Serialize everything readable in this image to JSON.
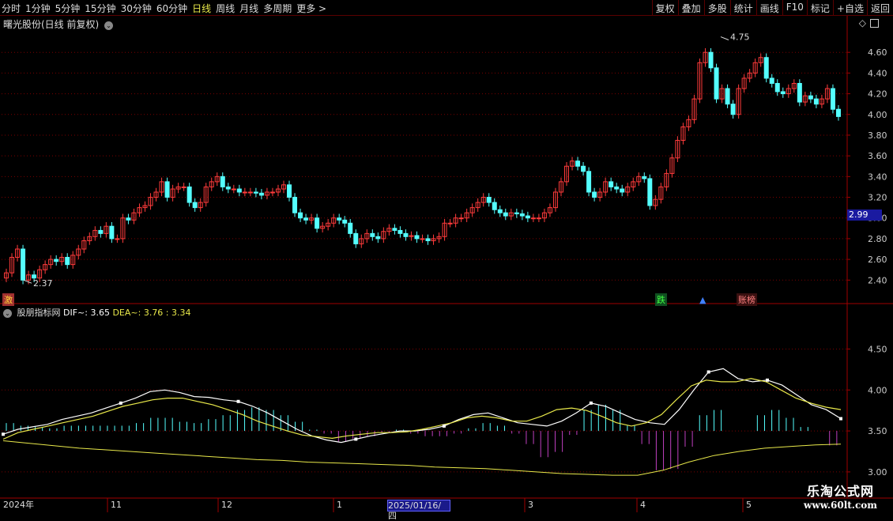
{
  "toolbar": {
    "left": [
      "分时",
      "1分钟",
      "5分钟",
      "15分钟",
      "30分钟",
      "60分钟",
      "日线",
      "周线",
      "月线",
      "多周期",
      "更多 >"
    ],
    "active_index": 6,
    "right": [
      "复权",
      "叠加",
      "多股",
      "统计",
      "画线",
      "F10",
      "标记",
      "+自选",
      "返回"
    ]
  },
  "main_title": "曙光股份(日线 前复权)",
  "indicator_title": {
    "name": "股朋指标网",
    "dif_label": "DIF~: 3.65",
    "dea_label": "DEA~: 3.76 : 3.34"
  },
  "price_box": "2.99",
  "badges": {
    "left": "激",
    "drop": "跌",
    "limit": "账榜"
  },
  "dates": {
    "year": "2024年",
    "selected": "2025/01/16/四",
    "months": [
      "11",
      "12",
      "1",
      "3",
      "4",
      "5"
    ]
  },
  "logo": {
    "line1": "乐淘公式网",
    "line2": "www.60lt.com"
  },
  "colors": {
    "up": "#ff3b3b",
    "down": "#54ffff",
    "grid": "#7a0000",
    "axis": "#a00000",
    "dif": "#ffffff",
    "dea": "#e8e84a",
    "hist_pos": "#54ffff",
    "hist_neg": "#c040c0"
  },
  "chart_data": [
    {
      "type": "candlestick",
      "title": "曙光股份(日线 前复权)",
      "y_ticks": [
        "4.60",
        "4.40",
        "4.20",
        "4.00",
        "3.80",
        "3.60",
        "3.40",
        "3.20",
        "3.00",
        "2.80",
        "2.60",
        "2.40"
      ],
      "ylim": [
        2.28,
        4.8
      ],
      "annotations": [
        {
          "text": "4.75",
          "value": 4.75
        },
        {
          "text": "2.37",
          "value": 2.37
        }
      ],
      "close": [
        2.47,
        2.62,
        2.7,
        2.4,
        2.45,
        2.42,
        2.5,
        2.55,
        2.6,
        2.58,
        2.62,
        2.55,
        2.64,
        2.7,
        2.78,
        2.82,
        2.88,
        2.85,
        2.92,
        2.8,
        2.8,
        3.0,
        2.98,
        3.05,
        3.1,
        3.12,
        3.2,
        3.25,
        3.35,
        3.2,
        3.28,
        3.3,
        3.3,
        3.15,
        3.1,
        3.15,
        3.3,
        3.35,
        3.4,
        3.3,
        3.28,
        3.28,
        3.25,
        3.25,
        3.25,
        3.24,
        3.22,
        3.25,
        3.25,
        3.28,
        3.32,
        3.2,
        3.05,
        3.0,
        2.98,
        3.0,
        2.9,
        2.92,
        2.95,
        3.0,
        2.98,
        2.95,
        2.85,
        2.75,
        2.8,
        2.85,
        2.82,
        2.8,
        2.87,
        2.9,
        2.88,
        2.85,
        2.82,
        2.83,
        2.8,
        2.8,
        2.78,
        2.8,
        2.82,
        2.95,
        2.95,
        3.0,
        3.0,
        3.05,
        3.1,
        3.15,
        3.2,
        3.15,
        3.08,
        3.05,
        3.02,
        3.05,
        3.04,
        3.02,
        3.0,
        3.0,
        3.0,
        3.05,
        3.1,
        3.25,
        3.35,
        3.5,
        3.55,
        3.5,
        3.45,
        3.25,
        3.2,
        3.25,
        3.35,
        3.3,
        3.28,
        3.25,
        3.3,
        3.35,
        3.4,
        3.38,
        3.12,
        3.18,
        3.3,
        3.43,
        3.58,
        3.75,
        3.88,
        3.95,
        4.15,
        4.5,
        4.6,
        4.45,
        4.15,
        4.25,
        4.1,
        4.0,
        4.25,
        4.35,
        4.4,
        4.5,
        4.55,
        4.35,
        4.3,
        4.22,
        4.2,
        4.25,
        4.3,
        4.12,
        4.18,
        4.15,
        4.1,
        4.15,
        4.25,
        4.05,
        3.98
      ],
      "volume": [],
      "low": [
        2.45,
        2.6,
        2.37
      ],
      "high": [
        4.75
      ]
    },
    {
      "type": "line",
      "title": "股朋指标网",
      "y_ticks": [
        "4.50",
        "4.00",
        "3.50",
        "3.00"
      ],
      "ylim": [
        2.7,
        4.9
      ],
      "series": [
        {
          "name": "DIF~",
          "values": [
            3.46,
            3.52,
            3.55,
            3.58,
            3.64,
            3.68,
            3.72,
            3.78,
            3.84,
            3.9,
            3.98,
            4.0,
            3.97,
            3.92,
            3.91,
            3.88,
            3.86,
            3.8,
            3.72,
            3.62,
            3.52,
            3.44,
            3.39,
            3.36,
            3.4,
            3.44,
            3.47,
            3.5,
            3.5,
            3.52,
            3.56,
            3.64,
            3.7,
            3.72,
            3.66,
            3.6,
            3.58,
            3.56,
            3.62,
            3.72,
            3.84,
            3.8,
            3.72,
            3.64,
            3.6,
            3.58,
            3.76,
            4.0,
            4.22,
            4.26,
            4.14,
            4.1,
            4.12,
            4.06,
            3.94,
            3.82,
            3.76,
            3.65
          ]
        },
        {
          "name": "DEA~",
          "values": [
            3.4,
            3.48,
            3.52,
            3.56,
            3.6,
            3.64,
            3.68,
            3.74,
            3.8,
            3.84,
            3.88,
            3.9,
            3.9,
            3.86,
            3.82,
            3.76,
            3.7,
            3.62,
            3.56,
            3.5,
            3.45,
            3.43,
            3.41,
            3.44,
            3.46,
            3.48,
            3.48,
            3.49,
            3.52,
            3.56,
            3.6,
            3.66,
            3.68,
            3.66,
            3.62,
            3.62,
            3.68,
            3.76,
            3.78,
            3.75,
            3.68,
            3.6,
            3.56,
            3.6,
            3.7,
            3.88,
            4.05,
            4.12,
            4.1,
            4.1,
            4.14,
            4.1,
            4.0,
            3.9,
            3.84,
            3.79,
            3.76
          ]
        },
        {
          "name": "",
          "values": [
            3.34
          ]
        }
      ]
    }
  ]
}
